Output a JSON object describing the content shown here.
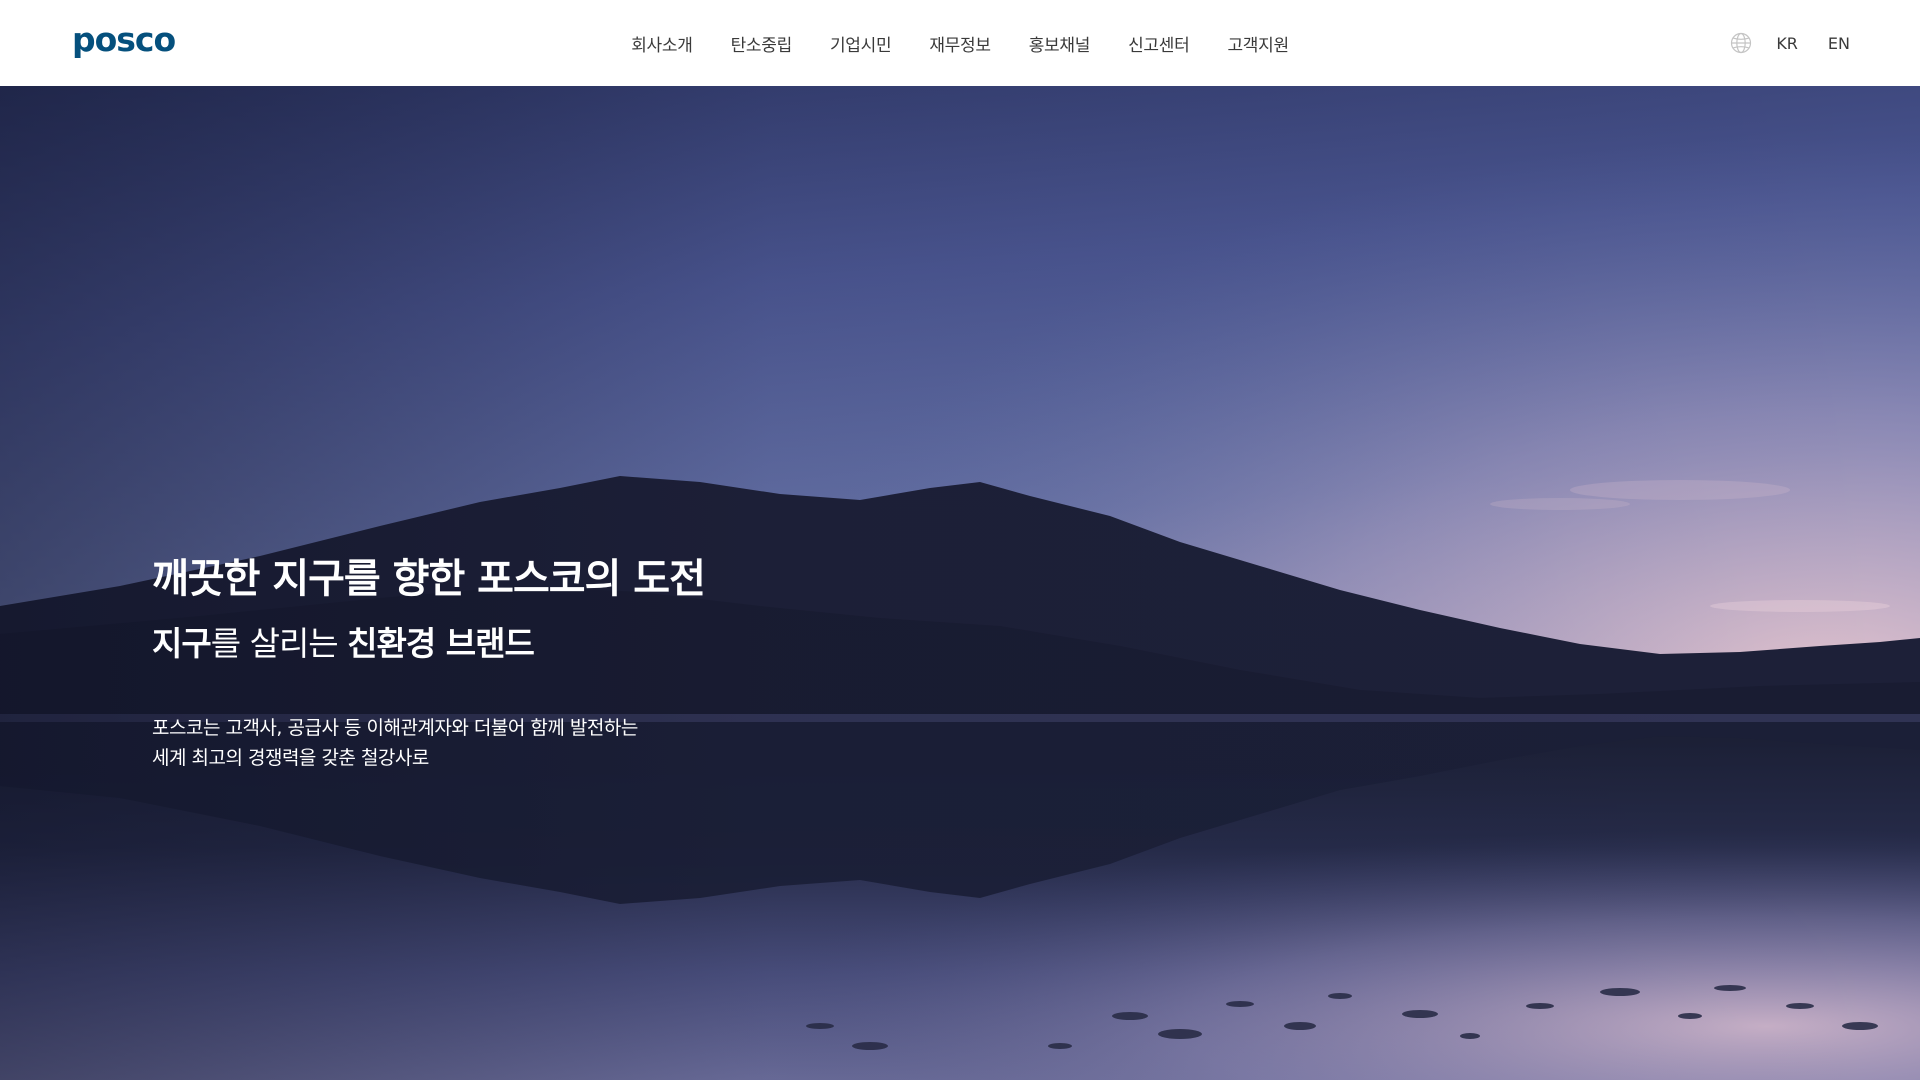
{
  "header": {
    "logo": "posco",
    "nav": [
      "회사소개",
      "탄소중립",
      "기업시민",
      "재무정보",
      "홍보채널",
      "신고센터",
      "고객지원"
    ],
    "utils": {
      "globe_icon": "globe-icon",
      "languages": [
        "KR",
        "EN"
      ]
    }
  },
  "hero": {
    "title": "깨끗한 지구를 향한 포스코의 도전",
    "subtitle": {
      "part1": "지구",
      "part2": "를 살리는 ",
      "part3": "친환경 브랜드"
    },
    "description": {
      "line1": "포스코는 고객사, 공급사 등 이해관계자와 더불어 함께 발전하는",
      "line2": "세계 최고의 경쟁력을 갖춘 철강사로"
    }
  },
  "colors": {
    "brand": "#05507d",
    "nav_text": "#3a3a3a",
    "header_bg": "#ffffff",
    "hero_text": "#ffffff"
  }
}
